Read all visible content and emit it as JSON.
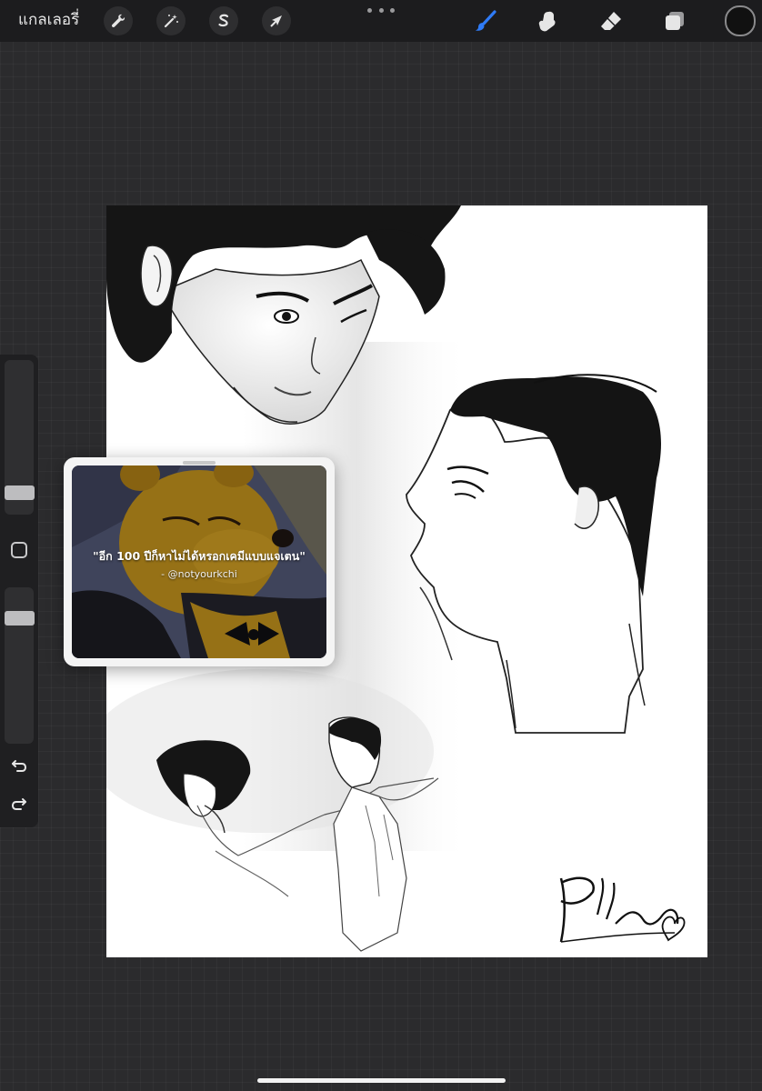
{
  "topbar": {
    "gallery_label": "แกลเลอรี่",
    "actions": [
      {
        "name": "actions",
        "icon": "wrench-icon"
      },
      {
        "name": "adjustments",
        "icon": "magic-wand-icon"
      },
      {
        "name": "selection",
        "icon": "selection-s-icon"
      },
      {
        "name": "transform",
        "icon": "arrow-cursor-icon"
      }
    ],
    "more_icon": "more-dots-icon",
    "tools": [
      {
        "name": "brush",
        "icon": "brush-icon",
        "active": true
      },
      {
        "name": "smudge",
        "icon": "smudge-finger-icon",
        "active": false
      },
      {
        "name": "eraser",
        "icon": "eraser-icon",
        "active": false
      },
      {
        "name": "layers",
        "icon": "layers-icon",
        "active": false
      }
    ],
    "current_color": "#111111",
    "accent_color": "#2f7bf6"
  },
  "sidebar": {
    "brush_size_level": 0.3,
    "opacity_level": 0.85,
    "modify_icon": "square-icon",
    "undo_icon": "undo-icon",
    "redo_icon": "redo-icon"
  },
  "reference": {
    "quote": "\"อีก 100 ปีก็หาไม่ได้หรอกเคมีแบบแจเตน\"",
    "author": "- @notyourkchi"
  },
  "canvas": {
    "background": "#ffffff",
    "signature_text": "Pledding"
  }
}
